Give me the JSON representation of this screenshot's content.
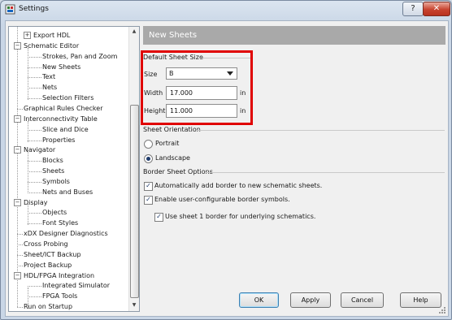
{
  "window": {
    "title": "Settings",
    "help_label": "?",
    "close_label": "✕"
  },
  "tree": {
    "items": [
      {
        "label": "Export HDL",
        "toggle": "+"
      },
      {
        "label": "Schematic Editor",
        "toggle": "−"
      },
      {
        "label": "Strokes, Pan and Zoom"
      },
      {
        "label": "New Sheets"
      },
      {
        "label": "Text"
      },
      {
        "label": "Nets"
      },
      {
        "label": "Selection Filters"
      },
      {
        "label": "Graphical Rules Checker"
      },
      {
        "label": "Interconnectivity Table",
        "toggle": "−"
      },
      {
        "label": "Slice and Dice"
      },
      {
        "label": "Properties"
      },
      {
        "label": "Navigator",
        "toggle": "−"
      },
      {
        "label": "Blocks"
      },
      {
        "label": "Sheets"
      },
      {
        "label": "Symbols"
      },
      {
        "label": "Nets and Buses"
      },
      {
        "label": "Display",
        "toggle": "−"
      },
      {
        "label": "Objects"
      },
      {
        "label": "Font Styles"
      },
      {
        "label": "xDX Designer Diagnostics"
      },
      {
        "label": "Cross Probing"
      },
      {
        "label": "Sheet/ICT Backup"
      },
      {
        "label": "Project Backup"
      },
      {
        "label": "HDL/FPGA Integration",
        "toggle": "−"
      },
      {
        "label": "Integrated Simulator"
      },
      {
        "label": "FPGA Tools"
      },
      {
        "label": "Run on Startup"
      }
    ]
  },
  "panel": {
    "title": "New Sheets",
    "default_size": {
      "group_label": "Default Sheet Size",
      "size_label": "Size",
      "size_value": "B",
      "width_label": "Width",
      "width_value": "17.000",
      "height_label": "Height",
      "height_value": "11.000",
      "unit": "in"
    },
    "orientation": {
      "group_label": "Sheet Orientation",
      "portrait_label": "Portrait",
      "landscape_label": "Landscape",
      "selected": "Landscape"
    },
    "border": {
      "group_label": "Border Sheet Options",
      "auto_add_label": "Automatically add border to new schematic sheets.",
      "user_config_label": "Enable user-configurable border symbols.",
      "use_sheet1_label": "Use sheet 1 border for underlying schematics.",
      "auto_add_checked": true,
      "user_config_checked": true,
      "use_sheet1_checked": true
    }
  },
  "buttons": {
    "ok": "OK",
    "apply": "Apply",
    "cancel": "Cancel",
    "help": "Help"
  },
  "colors": {
    "header_bg": "#a9a9a9",
    "highlight": "#e00000",
    "close_button": "#c8432f"
  }
}
